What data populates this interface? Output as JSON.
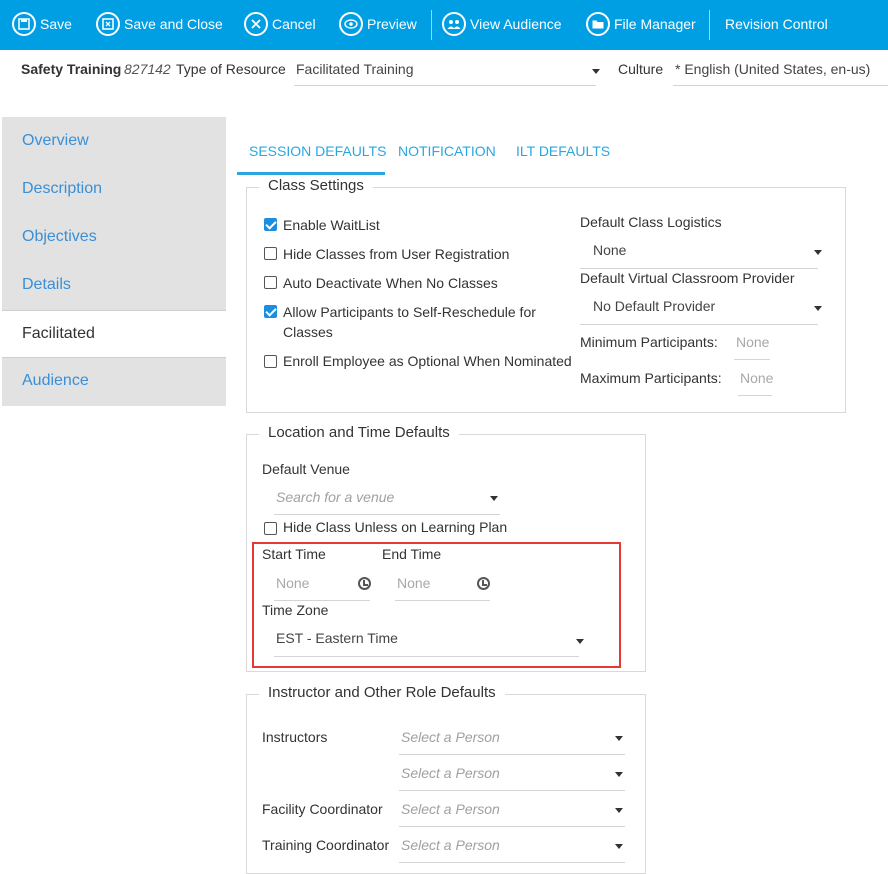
{
  "toolbar": {
    "save": "Save",
    "save_close": "Save and Close",
    "cancel": "Cancel",
    "preview": "Preview",
    "view_audience": "View Audience",
    "file_manager": "File Manager",
    "revision_control": "Revision Control"
  },
  "header": {
    "title": "Safety Training",
    "id": "827142",
    "resource_type_label": "Type of Resource",
    "resource_type_value": "Facilitated Training",
    "culture_label": "Culture",
    "culture_value": "* English (United States, en-us)"
  },
  "sidebar": {
    "items": [
      {
        "label": "Overview"
      },
      {
        "label": "Description"
      },
      {
        "label": "Objectives"
      },
      {
        "label": "Details"
      },
      {
        "label": "Facilitated"
      },
      {
        "label": "Audience"
      }
    ]
  },
  "tabs": [
    {
      "label": "SESSION DEFAULTS"
    },
    {
      "label": "NOTIFICATION"
    },
    {
      "label": "ILT DEFAULTS"
    }
  ],
  "class_settings": {
    "legend": "Class Settings",
    "enable_waitlist": "Enable WaitList",
    "hide_classes": "Hide Classes from User Registration",
    "auto_deactivate": "Auto Deactivate When No Classes",
    "allow_reschedule_1": "Allow Participants to Self-Reschedule for",
    "allow_reschedule_2": "Classes",
    "enroll_optional": "Enroll Employee as Optional When Nominated",
    "logistics_label": "Default Class Logistics",
    "logistics_value": "None",
    "virtual_label": "Default Virtual Classroom Provider",
    "virtual_value": "No Default Provider",
    "min_label": "Minimum Participants:",
    "min_value": "None",
    "max_label": "Maximum Participants:",
    "max_value": "None"
  },
  "location": {
    "legend": "Location and Time Defaults",
    "venue_label": "Default Venue",
    "venue_placeholder": "Search for a venue",
    "hide_class": "Hide Class Unless on Learning Plan",
    "start_label": "Start Time",
    "start_value": "None",
    "end_label": "End Time",
    "end_value": "None",
    "tz_label": "Time Zone",
    "tz_value": "EST - Eastern Time"
  },
  "instructor": {
    "legend": "Instructor and Other Role Defaults",
    "instructors_label": "Instructors",
    "facility_label": "Facility Coordinator",
    "training_label": "Training Coordinator",
    "placeholder": "Select a Person"
  }
}
